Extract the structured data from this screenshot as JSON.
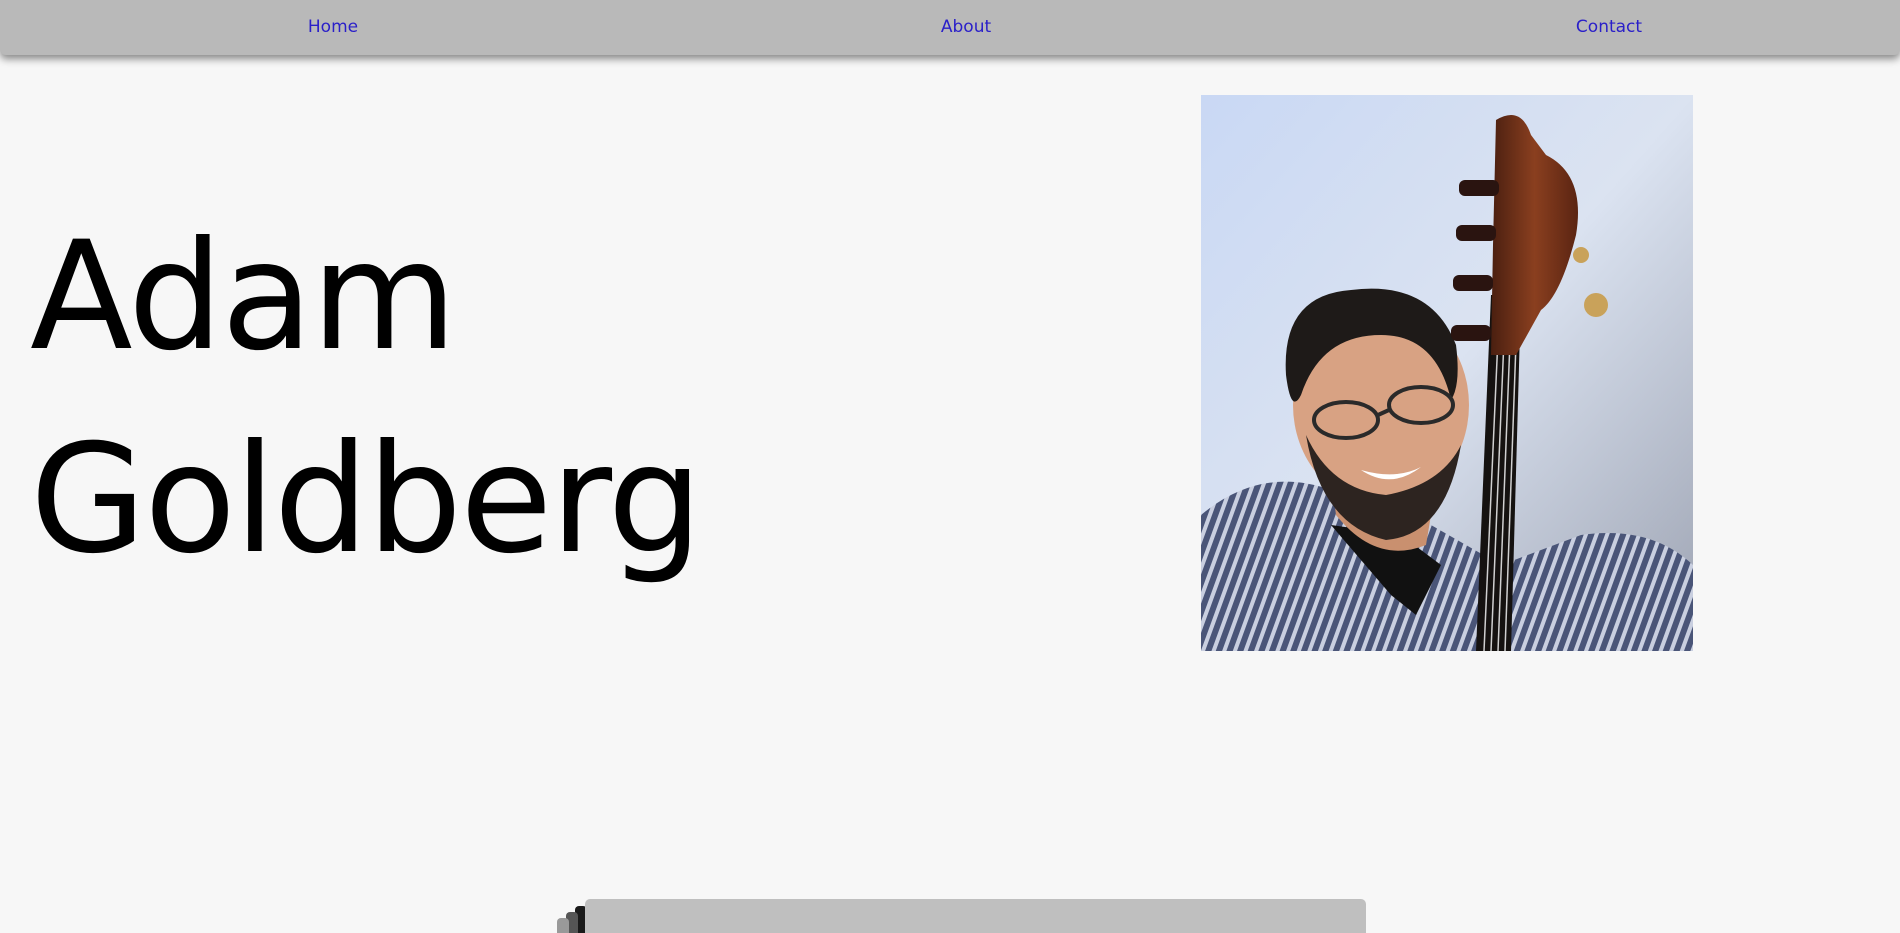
{
  "nav": {
    "items": [
      {
        "label": "Home"
      },
      {
        "label": "About"
      },
      {
        "label": "Contact"
      }
    ],
    "link_color": "#2a1fc9",
    "bar_color": "#b9b9b9"
  },
  "hero": {
    "first_name": "Adam",
    "last_name": "Goldberg"
  },
  "photo": {
    "icon": "portrait-photo"
  },
  "colors": {
    "background": "#f7f7f7",
    "card": "#bfbfbf"
  }
}
